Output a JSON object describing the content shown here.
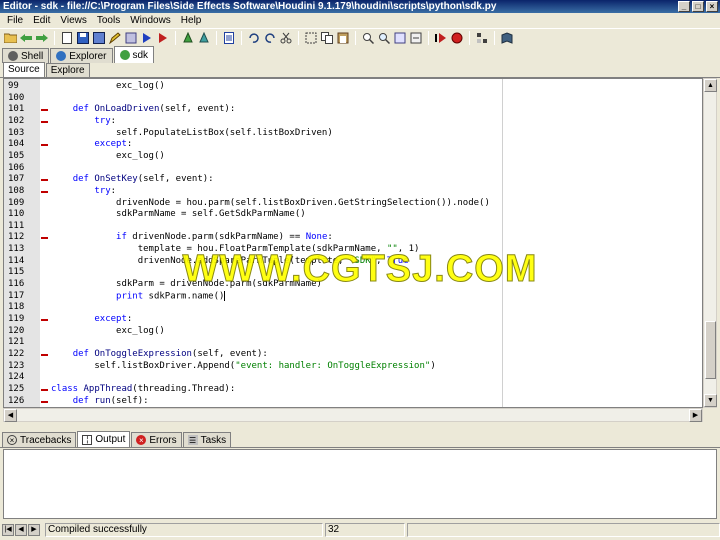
{
  "window": {
    "title": "Editor - sdk - file://C:\\Program Files\\Side Effects Software\\Houdini 9.1.179\\houdini\\scripts\\python\\sdk.py",
    "min_glyph": "_",
    "max_glyph": "□",
    "close_glyph": "×"
  },
  "menu": [
    "File",
    "Edit",
    "Views",
    "Tools",
    "Windows",
    "Help"
  ],
  "pane_tabs": [
    "Shell",
    "Explorer",
    "sdk"
  ],
  "sub_tabs": [
    "Source",
    "Explore"
  ],
  "code_lines": [
    {
      "n": "99",
      "fold": false,
      "html": "            exc_log()"
    },
    {
      "n": "100",
      "fold": false,
      "html": ""
    },
    {
      "n": "101",
      "fold": true,
      "html": "    <span class=\"kw\">def</span> <span class=\"fn\">OnLoadDriven</span>(self, event):"
    },
    {
      "n": "102",
      "fold": true,
      "html": "        <span class=\"kw\">try</span>:"
    },
    {
      "n": "103",
      "fold": false,
      "html": "            self.PopulateListBox(self.listBoxDriven)"
    },
    {
      "n": "104",
      "fold": true,
      "html": "        <span class=\"kw\">except</span>:"
    },
    {
      "n": "105",
      "fold": false,
      "html": "            exc_log()"
    },
    {
      "n": "106",
      "fold": false,
      "html": ""
    },
    {
      "n": "107",
      "fold": true,
      "html": "    <span class=\"kw\">def</span> <span class=\"fn\">OnSetKey</span>(self, event):"
    },
    {
      "n": "108",
      "fold": true,
      "html": "        <span class=\"kw\">try</span>:"
    },
    {
      "n": "109",
      "fold": false,
      "html": "            drivenNode = hou.parm(self.listBoxDriven.GetStringSelection()).node()"
    },
    {
      "n": "110",
      "fold": false,
      "html": "            sdkParmName = self.GetSdkParmName()"
    },
    {
      "n": "111",
      "fold": false,
      "html": ""
    },
    {
      "n": "112",
      "fold": true,
      "html": "            <span class=\"kw\">if</span> drivenNode.parm(sdkParmName) == <span class=\"kw\">None</span>:"
    },
    {
      "n": "113",
      "fold": false,
      "html": "                template = hou.FloatParmTemplate(sdkParmName, <span class=\"str\">\"\"</span>, 1)"
    },
    {
      "n": "114",
      "fold": false,
      "html": "                drivenNode.addSpareParmTuple(template, <span class=\"str\">\"SDK\"</span>, <span class=\"kw\">True</span>"
    },
    {
      "n": "115",
      "fold": false,
      "html": ""
    },
    {
      "n": "116",
      "fold": false,
      "html": "            sdkParm = drivenNode.parm(sdkParmName)"
    },
    {
      "n": "117",
      "fold": false,
      "html": "            <span class=\"kw\">print</span> sdkParm.name()<span class=\"cursor\"></span>"
    },
    {
      "n": "118",
      "fold": false,
      "html": ""
    },
    {
      "n": "119",
      "fold": true,
      "html": "        <span class=\"kw\">except</span>:"
    },
    {
      "n": "120",
      "fold": false,
      "html": "            exc_log()"
    },
    {
      "n": "121",
      "fold": false,
      "html": ""
    },
    {
      "n": "122",
      "fold": true,
      "html": "    <span class=\"kw\">def</span> <span class=\"fn\">OnToggleExpression</span>(self, event):"
    },
    {
      "n": "123",
      "fold": false,
      "html": "        self.listBoxDriver.Append(<span class=\"str\">\"event: handler: OnToggleExpression\"</span>)"
    },
    {
      "n": "124",
      "fold": false,
      "html": ""
    },
    {
      "n": "125",
      "fold": true,
      "html": "<span class=\"kw\">class</span> <span class=\"fn\">AppThread</span>(threading.Thread):"
    },
    {
      "n": "126",
      "fold": true,
      "html": "    <span class=\"kw\">def</span> <span class=\"fn\">run</span>(self):"
    }
  ],
  "watermark": "WWW.CGTSJ.COM",
  "bottom_tabs": [
    "Tracebacks",
    "Output",
    "Errors",
    "Tasks"
  ],
  "status": {
    "message": "Compiled successfully",
    "column": "32"
  }
}
